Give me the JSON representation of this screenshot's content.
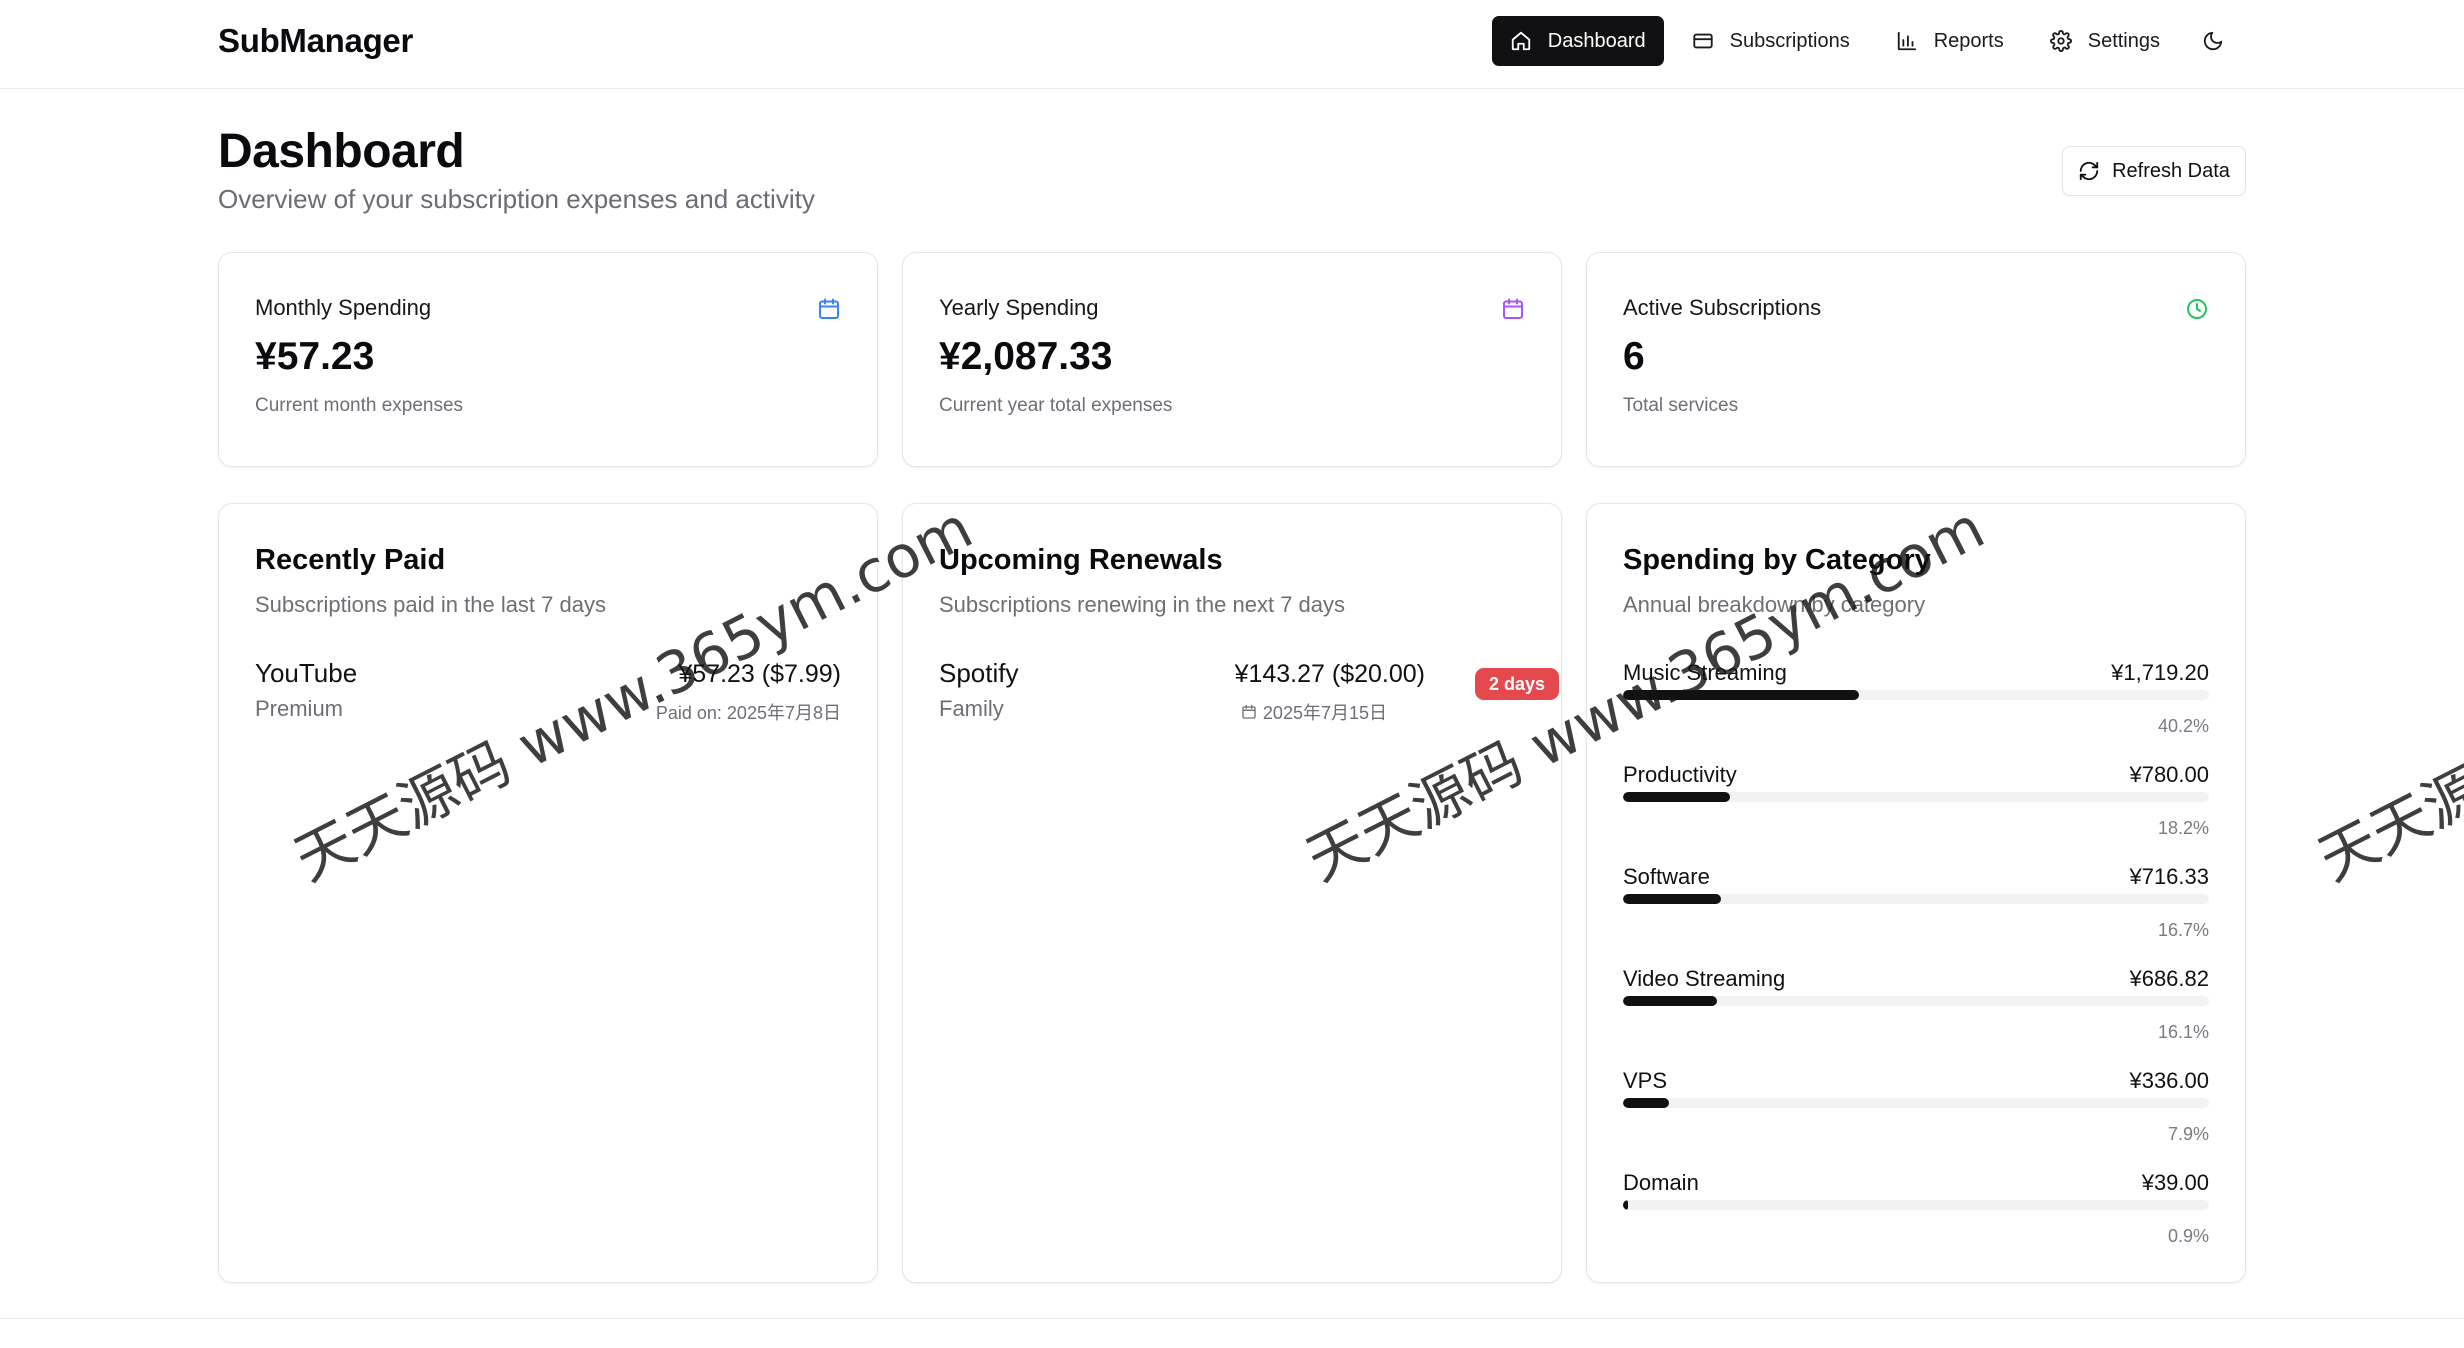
{
  "app": {
    "brand": "SubManager"
  },
  "nav": {
    "items": [
      {
        "label": "Dashboard",
        "icon": "home-icon",
        "active": true
      },
      {
        "label": "Subscriptions",
        "icon": "credit-card-icon"
      },
      {
        "label": "Reports",
        "icon": "bar-chart-icon"
      },
      {
        "label": "Settings",
        "icon": "gear-icon"
      }
    ],
    "theme_icon": "moon-icon"
  },
  "page": {
    "title": "Dashboard",
    "subtitle": "Overview of your subscription expenses and activity",
    "refresh_label": "Refresh Data"
  },
  "stats": [
    {
      "label": "Monthly Spending",
      "value": "¥57.23",
      "desc": "Current month expenses",
      "icon": "calendar-icon",
      "color": "#3b82f6"
    },
    {
      "label": "Yearly Spending",
      "value": "¥2,087.33",
      "desc": "Current year total expenses",
      "icon": "calendar-icon",
      "color": "#a855f7"
    },
    {
      "label": "Active Subscriptions",
      "value": "6",
      "desc": "Total services",
      "icon": "clock-icon",
      "color": "#22c55e"
    }
  ],
  "recently_paid": {
    "title": "Recently Paid",
    "subtitle": "Subscriptions paid in the last 7 days",
    "items": [
      {
        "name": "YouTube",
        "plan": "Premium",
        "price": "¥57.23 ($7.99)",
        "meta": "Paid on: 2025年7月8日"
      }
    ]
  },
  "upcoming": {
    "title": "Upcoming Renewals",
    "subtitle": "Subscriptions renewing in the next 7 days",
    "items": [
      {
        "name": "Spotify",
        "plan": "Family",
        "price": "¥143.27 ($20.00)",
        "date": "2025年7月15日",
        "badge": "2 days",
        "badge_color": "#e5484d"
      }
    ]
  },
  "categories": {
    "title": "Spending by Category",
    "subtitle": "Annual breakdown by category",
    "items": [
      {
        "name": "Music Streaming",
        "amount": "¥1,719.20",
        "pct_label": "40.2%",
        "pct": 40.2
      },
      {
        "name": "Productivity",
        "amount": "¥780.00",
        "pct_label": "18.2%",
        "pct": 18.2
      },
      {
        "name": "Software",
        "amount": "¥716.33",
        "pct_label": "16.7%",
        "pct": 16.7
      },
      {
        "name": "Video Streaming",
        "amount": "¥686.82",
        "pct_label": "16.1%",
        "pct": 16.1
      },
      {
        "name": "VPS",
        "amount": "¥336.00",
        "pct_label": "7.9%",
        "pct": 7.9
      },
      {
        "name": "Domain",
        "amount": "¥39.00",
        "pct_label": "0.9%",
        "pct": 0.9
      }
    ]
  },
  "watermark": {
    "text": "天天源码 www.365ym.com"
  }
}
